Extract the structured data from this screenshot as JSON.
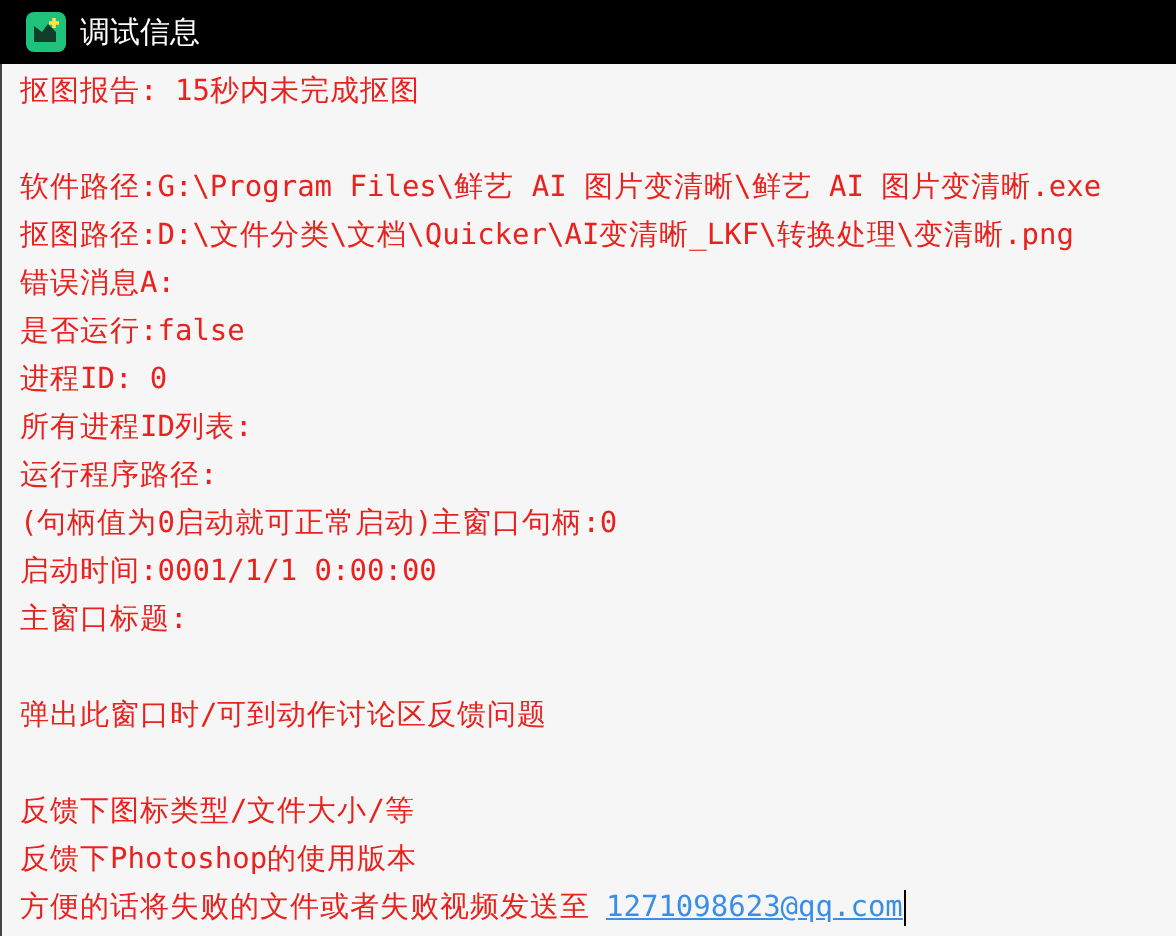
{
  "window": {
    "title": "调试信息"
  },
  "paragraphs": [
    [
      {
        "text": "抠图报告: 15秒内未完成抠图"
      }
    ],
    [
      {
        "text": "软件路径:G:\\Program Files\\鲜艺 AI 图片变清晰\\鲜艺 AI 图片变清晰.exe"
      },
      {
        "text": "抠图路径:D:\\文件分类\\文档\\Quicker\\AI变清晰_LKF\\转换处理\\变清晰.png"
      },
      {
        "text": "错误消息A:"
      },
      {
        "text": "是否运行:false"
      },
      {
        "text": "进程ID: 0"
      },
      {
        "text": "所有进程ID列表:"
      },
      {
        "text": "运行程序路径:"
      },
      {
        "text": "(句柄值为0启动就可正常启动)主窗口句柄:0"
      },
      {
        "text": "启动时间:0001/1/1 0:00:00"
      },
      {
        "text": "主窗口标题:"
      }
    ],
    [
      {
        "text": "弹出此窗口时/可到动作讨论区反馈问题"
      }
    ],
    [
      {
        "text": "反馈下图标类型/文件大小/等"
      },
      {
        "text": "反馈下Photoshop的使用版本"
      },
      {
        "text": "方便的话将失败的文件或者失败视频发送至",
        "link": "1271098623@qq.com"
      }
    ]
  ]
}
